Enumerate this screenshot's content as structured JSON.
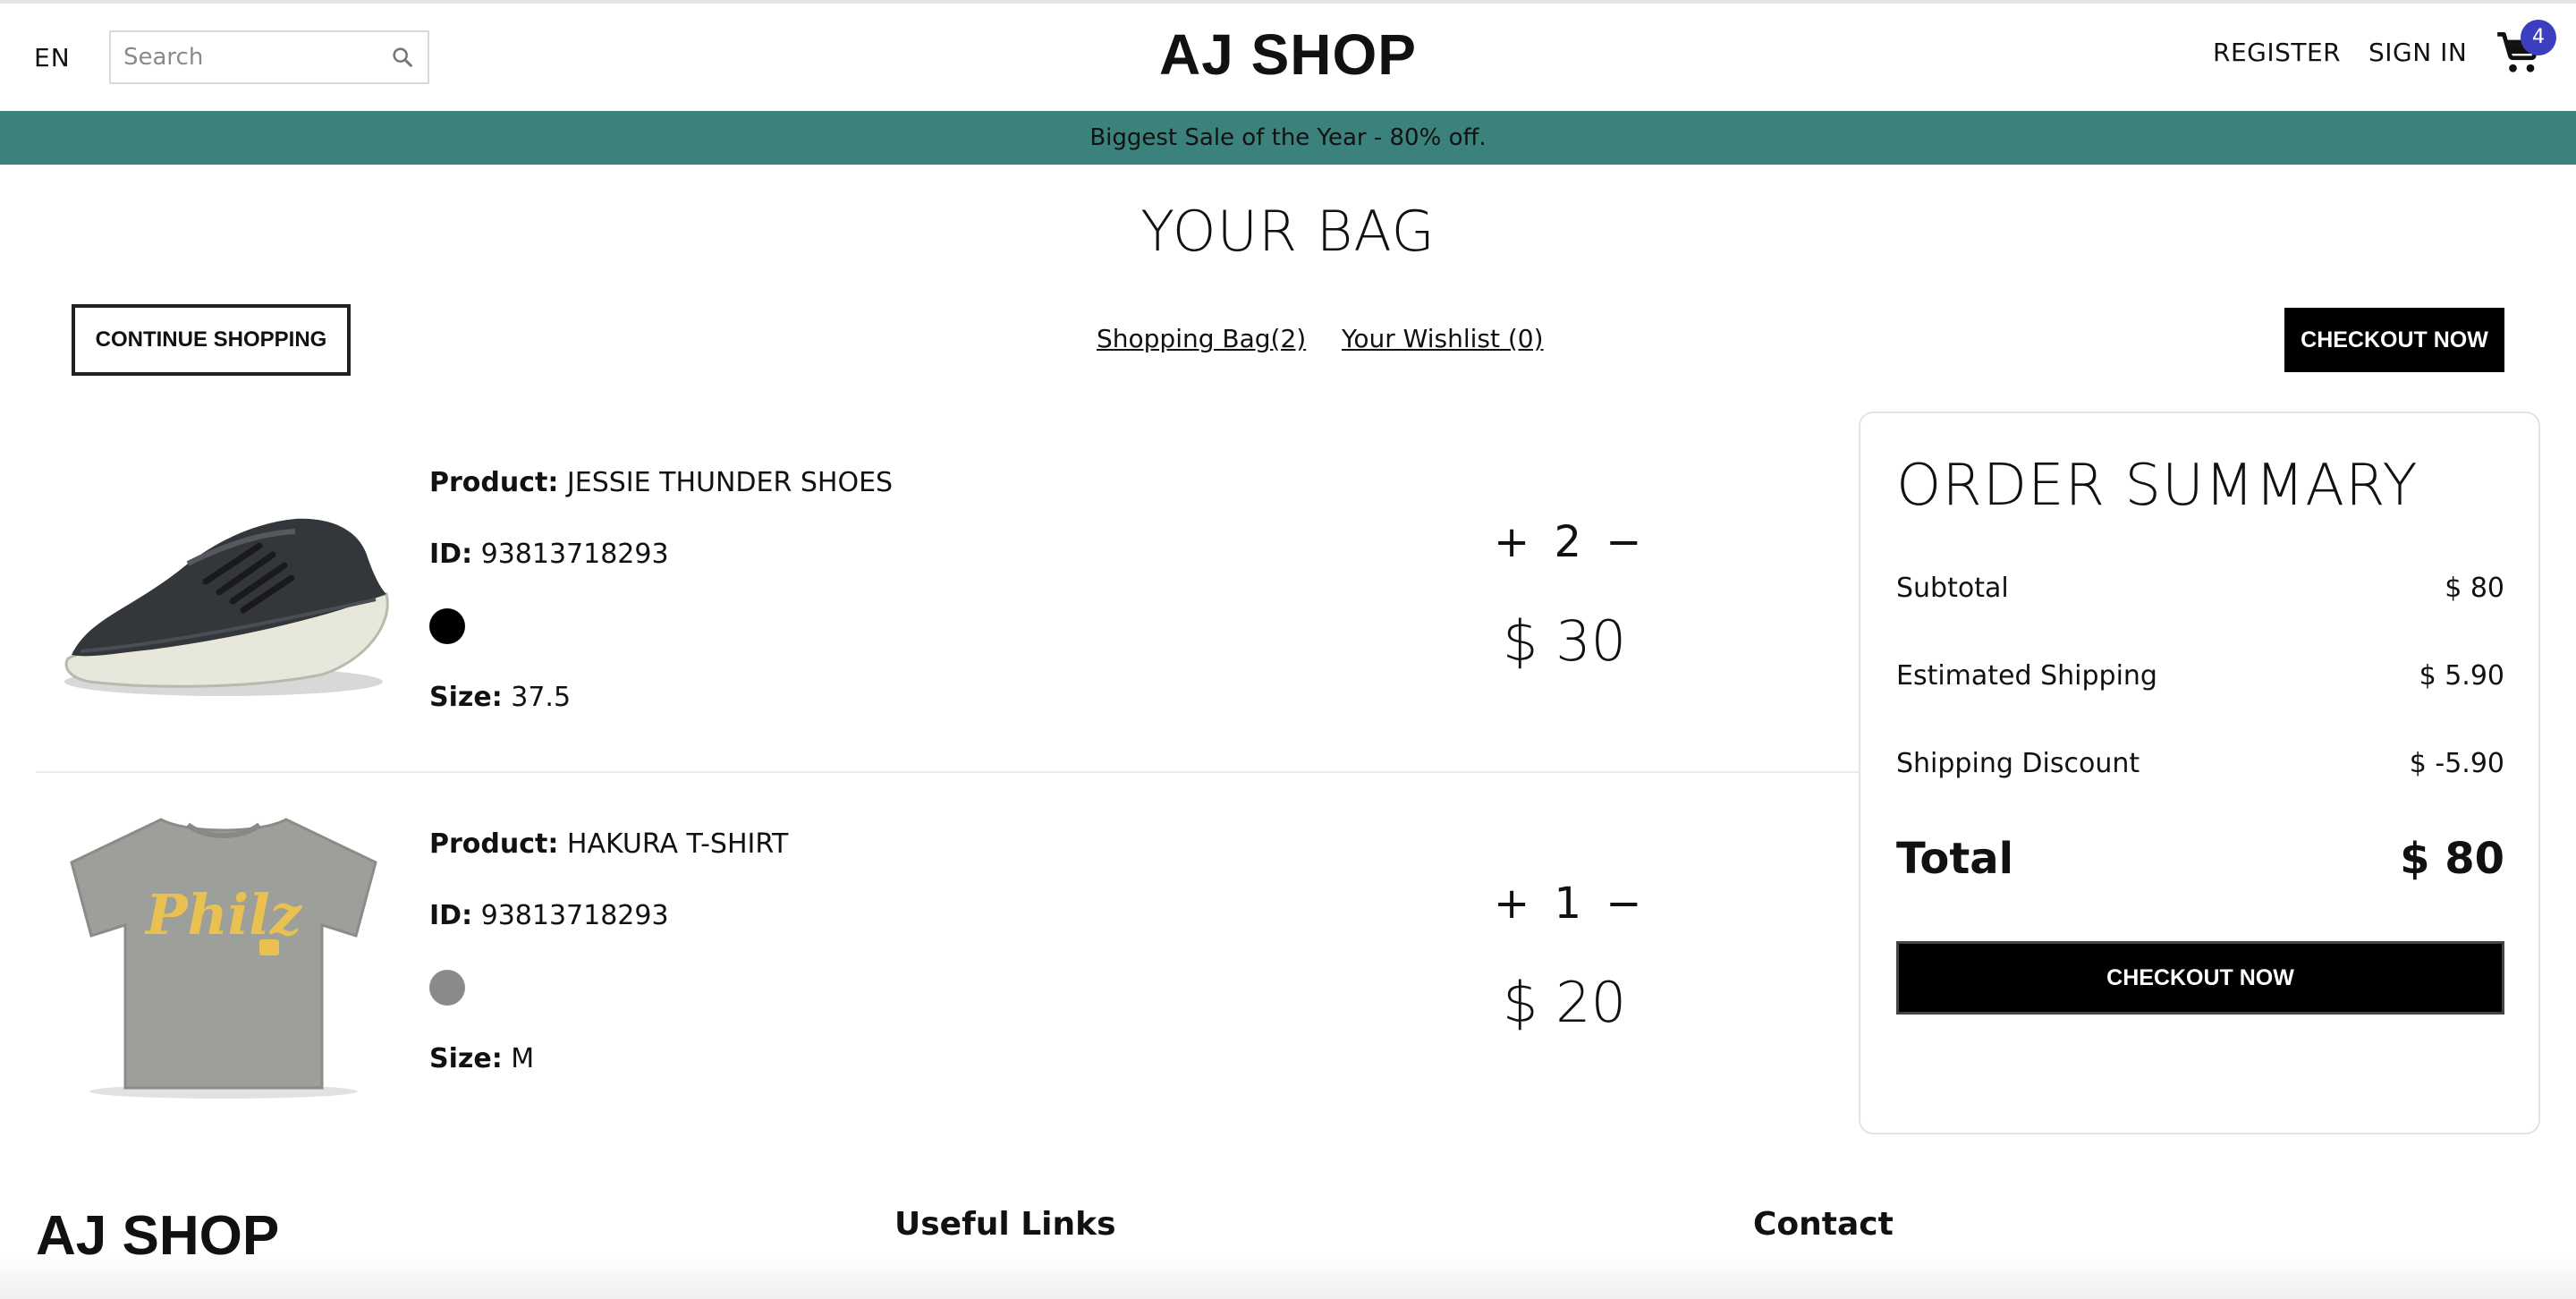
{
  "navbar": {
    "language": "EN",
    "search_placeholder": "Search",
    "brand": "AJ SHOP",
    "register": "REGISTER",
    "sign_in": "SIGN IN",
    "cart_count": "4"
  },
  "announcement": "Biggest Sale of the Year - 80% off.",
  "page": {
    "title": "YOUR BAG",
    "continue_shopping": "CONTINUE SHOPPING",
    "shopping_bag_tab": "Shopping Bag(2)",
    "wishlist_tab": "Your Wishlist (0)",
    "checkout_top": "CHECKOUT NOW"
  },
  "labels": {
    "product": "Product:",
    "id": "ID:",
    "size": "Size:"
  },
  "products": [
    {
      "name": "JESSIE THUNDER SHOES",
      "id": "93813718293",
      "color": "#000000",
      "size": "37.5",
      "quantity": "2",
      "price": "$ 30",
      "image": "shoe"
    },
    {
      "name": "HAKURA T-SHIRT",
      "id": "93813718293",
      "color": "#8a8a8a",
      "size": "M",
      "quantity": "1",
      "price": "$ 20",
      "image": "t-shirt"
    }
  ],
  "summary": {
    "title": "ORDER SUMMARY",
    "subtotal_label": "Subtotal",
    "subtotal_value": "$ 80",
    "shipping_label": "Estimated Shipping",
    "shipping_value": "$ 5.90",
    "discount_label": "Shipping Discount",
    "discount_value": "$ -5.90",
    "total_label": "Total",
    "total_value": "$ 80",
    "checkout": "CHECKOUT NOW"
  },
  "footer": {
    "brand": "AJ SHOP",
    "useful_links": "Useful Links",
    "contact": "Contact"
  },
  "colors": {
    "announcement_bg": "#3b827d",
    "badge_bg": "#3b3fbf",
    "button_bg": "#000000"
  },
  "tshirt_print": "Philz"
}
